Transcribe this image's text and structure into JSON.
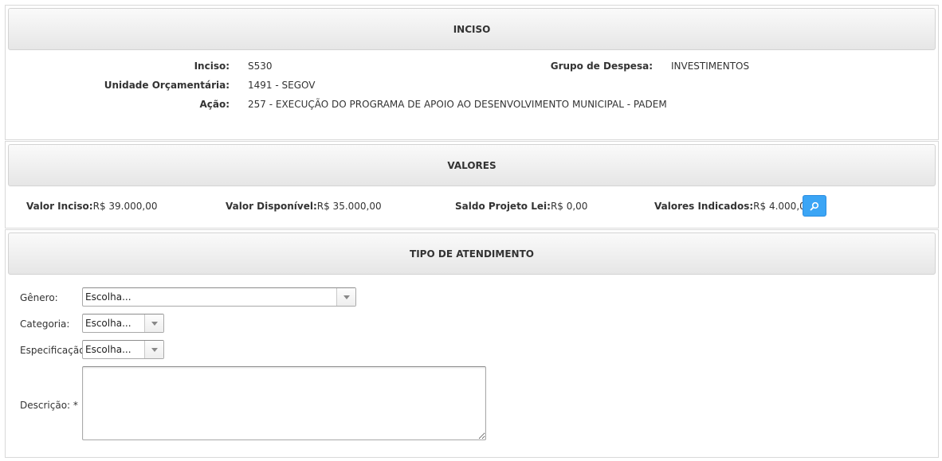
{
  "inciso_section": {
    "title": "INCISO",
    "inciso_label": "Inciso:",
    "inciso_value": "S530",
    "grupo_label": "Grupo de Despesa:",
    "grupo_value": "INVESTIMENTOS",
    "unidade_label": "Unidade Orçamentária:",
    "unidade_value": "1491 - SEGOV",
    "acao_label": "Ação:",
    "acao_value": "257 - EXECUÇÃO DO PROGRAMA DE APOIO AO DESENVOLVIMENTO MUNICIPAL - PADEM"
  },
  "valores_section": {
    "title": "VALORES",
    "valor_inciso_label": "Valor Inciso:",
    "valor_inciso_value": "R$ 39.000,00",
    "valor_disponivel_label": "Valor Disponível:",
    "valor_disponivel_value": "R$ 35.000,00",
    "saldo_label": "Saldo Projeto Lei:",
    "saldo_value": "R$ 0,00",
    "indicados_label": "Valores Indicados:",
    "indicados_value": "R$ 4.000,00",
    "search_icon": "search-icon",
    "accent_color": "#3ba5f5"
  },
  "atendimento_section": {
    "title": "TIPO DE ATENDIMENTO",
    "genero_label": "Gênero:",
    "genero_value": "Escolha...",
    "categoria_label": "Categoria:",
    "categoria_value": "Escolha...",
    "especificacao_label": "Especificação:",
    "especificacao_value": "Escolha...",
    "descricao_label": "Descrição: *",
    "descricao_value": ""
  }
}
